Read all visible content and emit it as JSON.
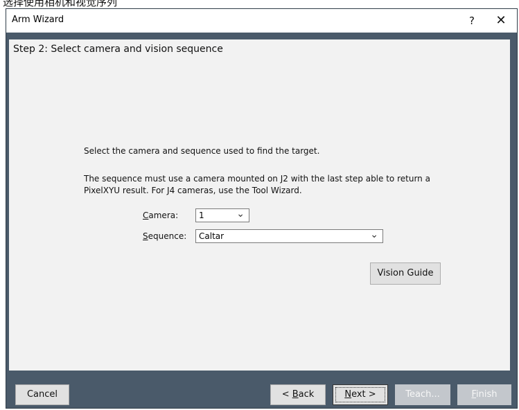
{
  "window": {
    "title": "Arm Wizard",
    "help_label": "?",
    "close_label": "✕"
  },
  "step": {
    "heading": "Step 2: Select camera and vision sequence",
    "instruction": "Select the camera and sequence used to find the target.",
    "note_line1": "The sequence must use a camera mounted on J2 with the last step able to return a",
    "note_line2": "PixelXYU result.  For J4 cameras, use the Tool Wizard."
  },
  "camera": {
    "label_prefix": "C",
    "label_rest": "amera:",
    "value": "1"
  },
  "sequence": {
    "label_prefix": "S",
    "label_rest": "equence:",
    "value": "Caltar"
  },
  "vision_guide_label": "Vision Guide",
  "buttons": {
    "cancel": "Cancel",
    "back_pre": "< ",
    "back_key": "B",
    "back_rest": "ack",
    "next_key": "N",
    "next_rest": "ext >",
    "teach": "Teach...",
    "finish_key": "F",
    "finish_rest": "inish"
  },
  "icons": {
    "chevron": "chevron-down-icon"
  }
}
